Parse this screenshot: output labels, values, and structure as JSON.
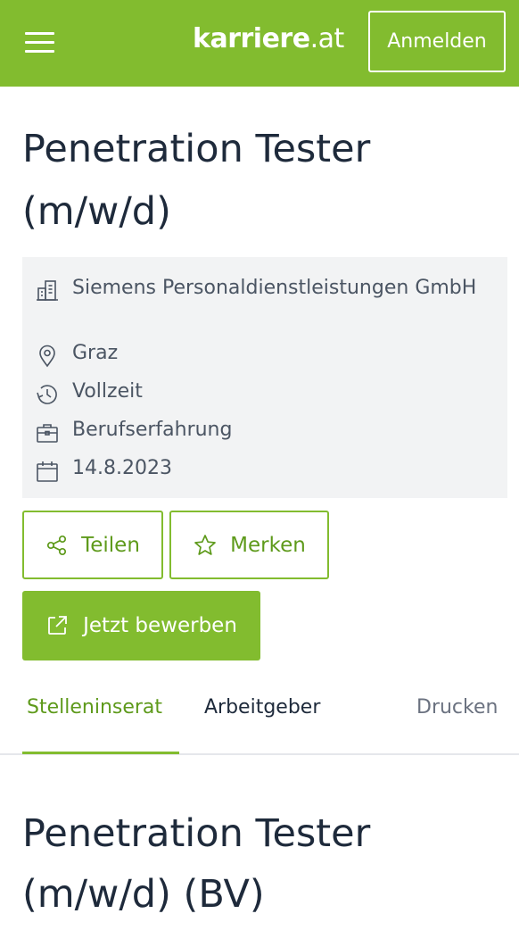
{
  "header": {
    "logo_main": "karriere",
    "logo_tld": ".at",
    "login_label": "Anmelden",
    "brand_color": "#82bc2f"
  },
  "job": {
    "title": "Penetration Tester (m/w/d)",
    "company": "Siemens Personaldienstleistungen GmbH",
    "location": "Graz",
    "employment_type": "Vollzeit",
    "experience": "Berufserfahrung",
    "date": "14.8.2023"
  },
  "actions": {
    "share_label": "Teilen",
    "save_label": "Merken",
    "apply_label": "Jetzt bewerben"
  },
  "tabs": {
    "items": [
      {
        "label": "Stelleninserat",
        "active": true
      },
      {
        "label": "Arbeitgeber",
        "active": false
      },
      {
        "label": "Drucken",
        "active": false
      }
    ]
  },
  "content": {
    "section_title": "Penetration Tester (m/w/d) (BV)"
  },
  "icons": {
    "menu": "hamburger-menu-icon",
    "company": "building-icon",
    "location": "map-pin-icon",
    "employment": "clock-icon",
    "experience": "briefcase-icon",
    "date": "calendar-icon",
    "share": "share-icon",
    "save": "star-icon",
    "apply": "external-link-icon"
  }
}
